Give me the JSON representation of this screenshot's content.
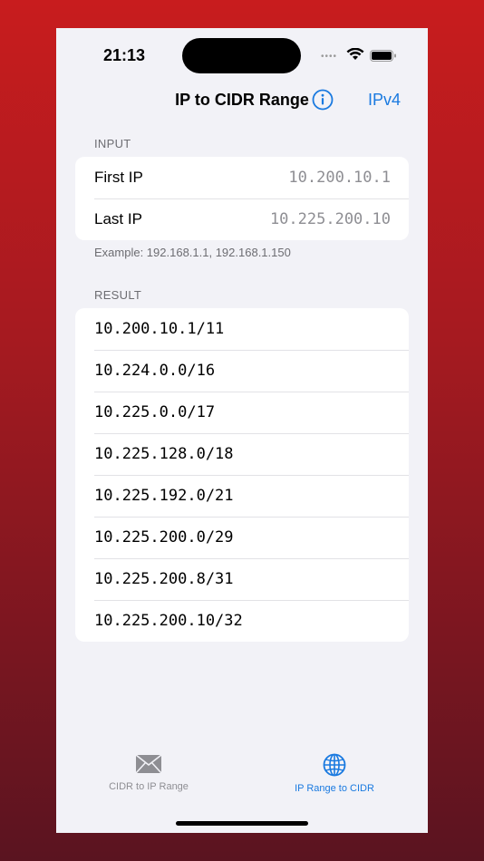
{
  "status_bar": {
    "time": "21:13",
    "dots": "••••"
  },
  "nav": {
    "title": "IP to CIDR Range",
    "info_icon": "info-circle-icon",
    "right_label": "IPv4"
  },
  "input": {
    "header": "INPUT",
    "rows": [
      {
        "label": "First IP",
        "value": "10.200.10.1"
      },
      {
        "label": "Last IP",
        "value": "10.225.200.10"
      }
    ],
    "footer": "Example: 192.168.1.1, 192.168.1.150"
  },
  "result": {
    "header": "RESULT",
    "items": [
      "10.200.10.1/11",
      "10.224.0.0/16",
      "10.225.0.0/17",
      "10.225.128.0/18",
      "10.225.192.0/21",
      "10.225.200.0/29",
      "10.225.200.8/31",
      "10.225.200.10/32"
    ]
  },
  "tabs": [
    {
      "label": "CIDR to IP Range",
      "icon": "envelope-icon",
      "active": false
    },
    {
      "label": "IP Range to CIDR",
      "icon": "globe-icon",
      "active": true
    }
  ],
  "colors": {
    "accent": "#1a7ae0",
    "inactive": "#8e8e93",
    "background": "#f2f2f7"
  }
}
